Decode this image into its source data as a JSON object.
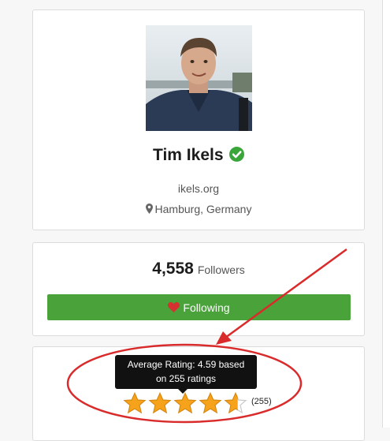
{
  "profile": {
    "name": "Tim Ikels",
    "website": "ikels.org",
    "location": "Hamburg, Germany"
  },
  "followers": {
    "count": "4,558",
    "label": "Followers",
    "button_label": "Following"
  },
  "rating": {
    "tooltip_line1": "Average Rating: 4.59 based",
    "tooltip_line2": "on 255 ratings",
    "value": 4.59,
    "max_stars": 5,
    "count_label": "(255)"
  },
  "icons": {
    "verified": "verified-check-icon",
    "location": "map-pin-icon",
    "heart": "heart-icon",
    "star": "star-icon"
  },
  "colors": {
    "follow_button": "#4aa23a",
    "verified_badge": "#3aa63a",
    "heart": "#d63031",
    "star": "#f7a21b",
    "annotation": "#d92b2b",
    "tooltip": "#111111"
  }
}
